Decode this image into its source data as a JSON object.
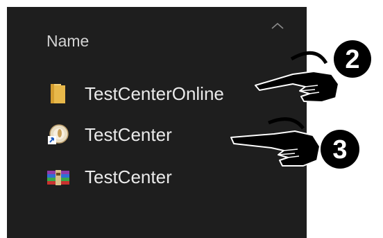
{
  "file_list": {
    "column_header": "Name",
    "items": [
      {
        "name": "TestCenterOnline",
        "icon": "folder-icon"
      },
      {
        "name": "TestCenter",
        "icon": "application-shortcut-icon"
      },
      {
        "name": "TestCenter",
        "icon": "winrar-archive-icon"
      }
    ]
  },
  "annotations": [
    {
      "number": "2"
    },
    {
      "number": "3"
    }
  ],
  "colors": {
    "background": "#1e1e1e",
    "text": "#eaeaea",
    "header_text": "#d2d2d2",
    "folder": "#e8b84a",
    "callout": "#000000"
  }
}
